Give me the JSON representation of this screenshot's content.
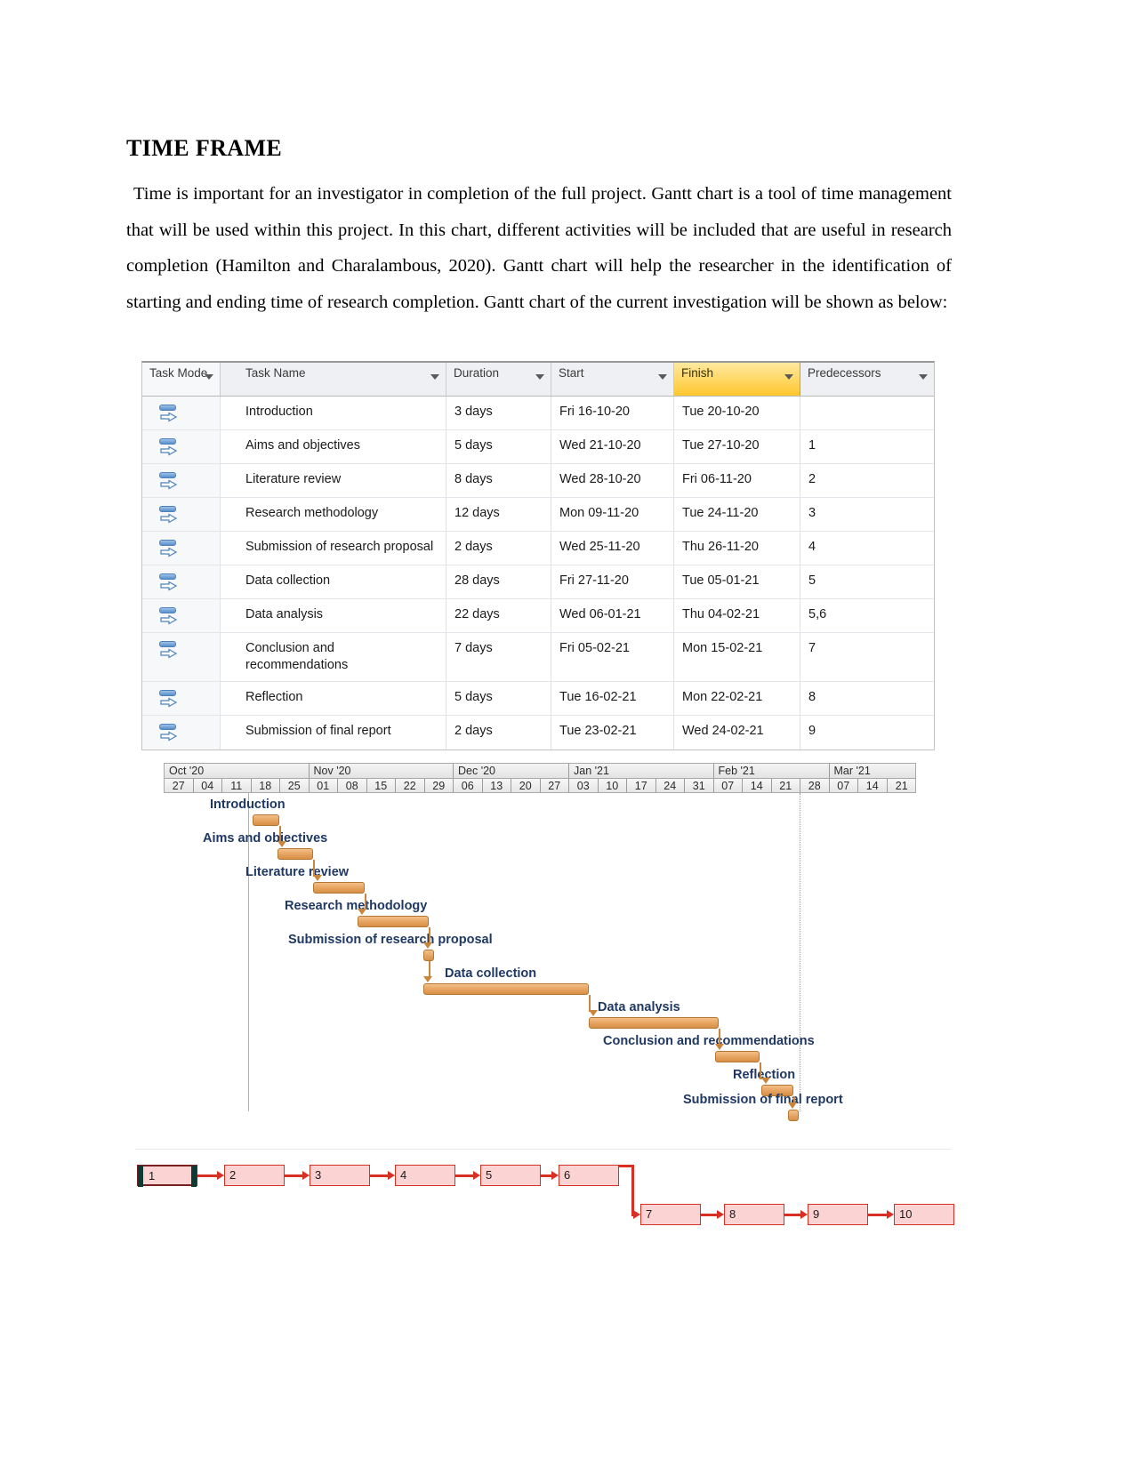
{
  "document": {
    "title": "TIME FRAME",
    "paragraph": " Time is important for an investigator in completion of the full project. Gantt chart is a tool of time management that will be used within this project. In this chart, different activities will be included that are useful in research completion (Hamilton and Charalambous, 2020). Gantt chart will help the researcher in the identification of starting and ending time of research completion. Gantt chart of the current investigation will be shown as below:"
  },
  "task_table": {
    "columns": [
      {
        "label": "Task Mode",
        "highlight": false,
        "filter": true
      },
      {
        "label": "Task Name",
        "highlight": false,
        "filter": true
      },
      {
        "label": "Duration",
        "highlight": false,
        "filter": true
      },
      {
        "label": "Start",
        "highlight": false,
        "filter": true
      },
      {
        "label": "Finish",
        "highlight": true,
        "filter": true
      },
      {
        "label": "Predecessors",
        "highlight": false,
        "filter": true
      }
    ],
    "rows": [
      {
        "id": 1,
        "mode": "auto-schedule-icon",
        "name": "Introduction",
        "duration": "3 days",
        "start": "Fri 16-10-20",
        "finish": "Tue 20-10-20",
        "predecessors": ""
      },
      {
        "id": 2,
        "mode": "auto-schedule-icon",
        "name": "Aims and objectives",
        "duration": "5 days",
        "start": "Wed 21-10-20",
        "finish": "Tue 27-10-20",
        "predecessors": "1"
      },
      {
        "id": 3,
        "mode": "auto-schedule-icon",
        "name": "Literature review",
        "duration": "8 days",
        "start": "Wed 28-10-20",
        "finish": "Fri 06-11-20",
        "predecessors": "2"
      },
      {
        "id": 4,
        "mode": "auto-schedule-icon",
        "name": "Research methodology",
        "duration": "12 days",
        "start": "Mon 09-11-20",
        "finish": "Tue 24-11-20",
        "predecessors": "3"
      },
      {
        "id": 5,
        "mode": "auto-schedule-icon",
        "name": "Submission of research proposal",
        "duration": "2 days",
        "start": "Wed 25-11-20",
        "finish": "Thu 26-11-20",
        "predecessors": "4"
      },
      {
        "id": 6,
        "mode": "auto-schedule-icon",
        "name": "Data collection",
        "duration": "28 days",
        "start": "Fri 27-11-20",
        "finish": "Tue 05-01-21",
        "predecessors": "5"
      },
      {
        "id": 7,
        "mode": "auto-schedule-icon",
        "name": "Data analysis",
        "duration": "22 days",
        "start": "Wed 06-01-21",
        "finish": "Thu 04-02-21",
        "predecessors": "5,6"
      },
      {
        "id": 8,
        "mode": "auto-schedule-icon",
        "name": "Conclusion and recommendations",
        "duration": "7 days",
        "start": "Fri 05-02-21",
        "finish": "Mon 15-02-21",
        "predecessors": "7"
      },
      {
        "id": 9,
        "mode": "auto-schedule-icon",
        "name": "Reflection",
        "duration": "5 days",
        "start": "Tue 16-02-21",
        "finish": "Mon 22-02-21",
        "predecessors": "8"
      },
      {
        "id": 10,
        "mode": "auto-schedule-icon",
        "name": "Submission of final report",
        "duration": "2 days",
        "start": "Tue 23-02-21",
        "finish": "Wed 24-02-21",
        "predecessors": "9"
      }
    ]
  },
  "chart_data": {
    "type": "bar",
    "title": "Gantt chart of the current investigation",
    "xlabel": "",
    "ylabel": "",
    "timeline": {
      "months": [
        {
          "label": "Oct '20",
          "weeks": 5
        },
        {
          "label": "Nov '20",
          "weeks": 5
        },
        {
          "label": "Dec '20",
          "weeks": 4
        },
        {
          "label": "Jan '21",
          "weeks": 5
        },
        {
          "label": "Feb '21",
          "weeks": 4
        },
        {
          "label": "Mar '21",
          "weeks": 3
        }
      ],
      "weeks": [
        "27",
        "04",
        "11",
        "18",
        "25",
        "01",
        "08",
        "15",
        "22",
        "29",
        "06",
        "13",
        "20",
        "27",
        "03",
        "10",
        "17",
        "24",
        "31",
        "07",
        "14",
        "21",
        "28",
        "07",
        "14",
        "21"
      ]
    },
    "categories": [
      "Introduction",
      "Aims and objectives",
      "Literature review",
      "Research methodology",
      "Submission of research proposal",
      "Data collection",
      "Data analysis",
      "Conclusion and recommendations",
      "Reflection",
      "Submission of final report"
    ],
    "values": [
      3,
      5,
      8,
      12,
      2,
      28,
      22,
      7,
      5,
      2
    ],
    "bars": [
      {
        "label": "Introduction",
        "start": "Fri 16-10-20",
        "finish": "Tue 20-10-20",
        "duration_days": 3,
        "milestone": false
      },
      {
        "label": "Aims and objectives",
        "start": "Wed 21-10-20",
        "finish": "Tue 27-10-20",
        "duration_days": 5,
        "milestone": false
      },
      {
        "label": "Literature review",
        "start": "Wed 28-10-20",
        "finish": "Fri 06-11-20",
        "duration_days": 8,
        "milestone": false
      },
      {
        "label": "Research methodology",
        "start": "Mon 09-11-20",
        "finish": "Tue 24-11-20",
        "duration_days": 12,
        "milestone": false
      },
      {
        "label": "Submission of research proposal",
        "start": "Wed 25-11-20",
        "finish": "Thu 26-11-20",
        "duration_days": 2,
        "milestone": true
      },
      {
        "label": "Data collection",
        "start": "Fri 27-11-20",
        "finish": "Tue 05-01-21",
        "duration_days": 28,
        "milestone": false
      },
      {
        "label": "Data analysis",
        "start": "Wed 06-01-21",
        "finish": "Thu 04-02-21",
        "duration_days": 22,
        "milestone": false
      },
      {
        "label": "Conclusion and recommendations",
        "start": "Fri 05-02-21",
        "finish": "Mon 15-02-21",
        "duration_days": 7,
        "milestone": false
      },
      {
        "label": "Reflection",
        "start": "Tue 16-02-21",
        "finish": "Mon 22-02-21",
        "duration_days": 5,
        "milestone": false
      },
      {
        "label": "Submission of final report",
        "start": "Tue 23-02-21",
        "finish": "Wed 24-02-21",
        "duration_days": 2,
        "milestone": true
      }
    ],
    "colors": {
      "bar": "#e8a765",
      "bar_border": "#b5762f",
      "link": "#c8853b",
      "label": "#1f3864"
    }
  },
  "network_diagram": {
    "type": "network",
    "nodes": [
      {
        "id": "1",
        "label": "1",
        "critical": true
      },
      {
        "id": "2",
        "label": "2",
        "critical": false
      },
      {
        "id": "3",
        "label": "3",
        "critical": false
      },
      {
        "id": "4",
        "label": "4",
        "critical": false
      },
      {
        "id": "5",
        "label": "5",
        "critical": false
      },
      {
        "id": "6",
        "label": "6",
        "critical": false
      },
      {
        "id": "7",
        "label": "7",
        "critical": false
      },
      {
        "id": "8",
        "label": "8",
        "critical": false
      },
      {
        "id": "9",
        "label": "9",
        "critical": false
      },
      {
        "id": "10",
        "label": "10",
        "critical": false
      }
    ],
    "edges": [
      [
        "1",
        "2"
      ],
      [
        "2",
        "3"
      ],
      [
        "3",
        "4"
      ],
      [
        "4",
        "5"
      ],
      [
        "5",
        "6"
      ],
      [
        "6",
        "7"
      ],
      [
        "7",
        "8"
      ],
      [
        "8",
        "9"
      ],
      [
        "9",
        "10"
      ]
    ],
    "colors": {
      "node_fill": "#fbd3d3",
      "node_border": "#d93025",
      "edge": "#d93025"
    }
  }
}
